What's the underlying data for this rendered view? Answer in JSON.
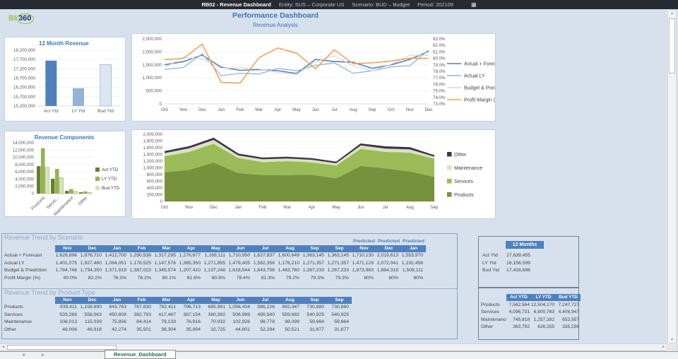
{
  "topbar": {
    "report": "RB02 - Revenue Dashboard",
    "entity": "Entity: SUS – Corporate US",
    "scenario": "Scenario: BUD – Budget",
    "period": "Period: 202109"
  },
  "header": {
    "title": "Performance Dashboard",
    "subtitle": "Revenue Analysis",
    "logo_bi": "BI",
    "logo_360": "360"
  },
  "icons": {
    "calendar": "▦",
    "nav_left": "◄",
    "nav_right": "►",
    "arrow_up": "▲",
    "arrow_down": "▼",
    "arrow_left": "◄",
    "arrow_right": "►"
  },
  "colors": {
    "accent_blue": "#4f81bd",
    "light_blue": "#95b3d7",
    "pale_blue": "#dce6f1",
    "orange": "#f2a15c",
    "products_green": "#76923c",
    "services_green": "#9bbb59",
    "maintenance_green": "#d7e4bc",
    "other_purple": "#403152",
    "title_blue": "#3f76b4",
    "tab_green": "#1e7145",
    "topbar_bg": "#262a31",
    "sheet_bg": "#d7e1ee"
  },
  "chart_data": [
    {
      "id": "twelve-month-revenue",
      "type": "bar",
      "title": "12 Month Revenue",
      "categories": [
        "Act Ytd",
        "LY Ytd",
        "Bud Ytd"
      ],
      "values": [
        17639455,
        16156599,
        17428696
      ],
      "bar_colors": [
        "#4f81bd",
        "#95b3d7",
        "#dce6f1"
      ],
      "ylim": [
        15200000,
        18200000
      ],
      "ystep": 500000,
      "grid": true,
      "legend_position": "none"
    },
    {
      "id": "revenue-analysis",
      "type": "line",
      "title": "Revenue Analysis",
      "x": [
        "Oct",
        "Nov",
        "Dec",
        "Jan",
        "Feb",
        "Mar",
        "Apr",
        "May",
        "Jun",
        "Jul",
        "Aug",
        "Sep",
        "Oct",
        "Nov",
        "Dec"
      ],
      "ylim": [
        0,
        2500000
      ],
      "ystep": 500000,
      "y2lim": [
        73,
        83
      ],
      "y2step": 1,
      "grid": true,
      "legend_position": "right",
      "series": [
        {
          "name": "Actual + Forecast",
          "color": "#4f81bd",
          "width": 1.6,
          "values": [
            1502000,
            1628896,
            1878710,
            1412700,
            1290538,
            1317295,
            1276677,
            1169111,
            1710950,
            1627837,
            1600649,
            1363145,
            1500000,
            1710130,
            2019613
          ]
        },
        {
          "name": "Actual LY",
          "color": "#95b3d7",
          "width": 1.3,
          "values": [
            1320000,
            1401075,
            1927480,
            1084051,
            1178525,
            1147576,
            1365350,
            1271855,
            1479405,
            1582356,
            1176210,
            1271357,
            1420000,
            1471129,
            2072041
          ]
        },
        {
          "name": "Budget & Prediction",
          "color": "#d8d8d8",
          "width": 1.2,
          "values": [
            1400000,
            1784746,
            1734250,
            1371919,
            1387023,
            1345574,
            1207410,
            1137248,
            1618544,
            1843756,
            1463760,
            1267233,
            1520000,
            1873983,
            1864319
          ]
        },
        {
          "name": "Profit Margin (%)",
          "color": "#f2a15c",
          "width": 1.6,
          "axis": "right",
          "values": [
            79.8,
            80.0,
            82.2,
            76.3,
            76.2,
            80.1,
            81.6,
            80.8,
            78.4,
            81.3,
            79.2,
            79.3,
            79.6,
            80,
            80
          ]
        }
      ]
    },
    {
      "id": "revenue-components",
      "type": "bar",
      "title": "Revenue Components",
      "categories": [
        "Products",
        "Servic...",
        "Maintenance",
        "Other"
      ],
      "ylim": [
        0,
        14000000
      ],
      "ystep": 2000000,
      "grid": true,
      "legend_position": "right",
      "series": [
        {
          "name": "Act YTD",
          "color": "#667d33",
          "values": [
            7562564,
            4096731,
            745818,
            363792
          ]
        },
        {
          "name": "LY YTD",
          "color": "#94b353",
          "values": [
            12504170,
            6800783,
            1257382,
            626255
          ]
        },
        {
          "name": "Bud YTD",
          "color": "#d6e3bb",
          "values": [
            7247727,
            4406947,
            652557,
            335236
          ]
        }
      ]
    },
    {
      "id": "revenue-components-trend",
      "type": "area",
      "x": [
        "Oct",
        "Nov",
        "Dec",
        "Jan",
        "Feb",
        "Mar",
        "Apr",
        "May",
        "Jun",
        "Jul",
        "Aug",
        "Sep"
      ],
      "ylim": [
        0,
        2000000
      ],
      "ystep": 200000,
      "grid": true,
      "legend_position": "right",
      "legend_order": [
        "Other",
        "Maintenance",
        "Services",
        "Products"
      ],
      "series": [
        {
          "name": "Products",
          "color": "#76923c",
          "values": [
            870000,
            939411,
            1158690,
            843763,
            787830,
            782411,
            796713,
            685961,
            1056434,
            986226,
            892347,
            730880
          ]
        },
        {
          "name": "Services",
          "color": "#9bbb59",
          "values": [
            470000,
            533266,
            558063,
            450808,
            382793,
            417447,
            367154,
            380392,
            506989,
            490540,
            559682,
            540925
          ]
        },
        {
          "name": "Maintenance",
          "color": "#d7e4bc",
          "values": [
            100000,
            108013,
            115039,
            75856,
            84414,
            79133,
            76916,
            70032,
            102926,
            98778,
            98099,
            59664
          ]
        },
        {
          "name": "Other",
          "color": "#403152",
          "values": [
            45000,
            48006,
            48918,
            42274,
            35501,
            38304,
            35894,
            32725,
            44601,
            52294,
            50521,
            31677
          ]
        }
      ]
    }
  ],
  "tables": {
    "scenario": {
      "title": "Revenue Trend by Scenario",
      "predicted_label": "Predicted",
      "predicted_from": 12,
      "columns": [
        "Nov",
        "Dec",
        "Jan",
        "Feb",
        "Mar",
        "Apr",
        "May",
        "Jun",
        "Jul",
        "Aug",
        "Sep",
        "Sep",
        "Nov",
        "Dec",
        "Jan"
      ],
      "rows": [
        {
          "label": "Actual + Forecast",
          "values": [
            "1,628,896",
            "1,878,710",
            "1,412,700",
            "1,290,538",
            "1,317,295",
            "1,276,677",
            "1,169,111",
            "1,710,950",
            "1,627,837",
            "1,600,649",
            "1,363,145",
            "1,363,145",
            "1,710,130",
            "2,019,613",
            "1,553,970"
          ]
        },
        {
          "label": "Actual LY",
          "values": [
            "1,401,075",
            "1,927,480",
            "1,084,051",
            "1,178,525",
            "1,147,576",
            "1,365,350",
            "1,271,855",
            "1,479,405",
            "1,582,356",
            "1,176,210",
            "1,271,357",
            "1,271,357",
            "1,471,129",
            "2,072,041",
            "1,192,458"
          ]
        },
        {
          "label": "Budget & Prediction",
          "values": [
            "1,784,746",
            "1,734,250",
            "1,371,919",
            "1,387,023",
            "1,345,574",
            "1,207,410",
            "1,137,248",
            "1,618,544",
            "1,843,756",
            "1,463,760",
            "1,267,233",
            "1,267,233",
            "1,873,983",
            "1,864,319",
            "1,509,111"
          ]
        },
        {
          "label": "Profit Margin (%)",
          "values": [
            "80.0%",
            "82.2%",
            "76.3%",
            "76.2%",
            "80.1%",
            "81.6%",
            "80.8%",
            "78.4%",
            "81.3%",
            "79.2%",
            "79.3%",
            "79.3%",
            "80%",
            "80%",
            "80%"
          ]
        }
      ]
    },
    "product": {
      "title": "Revenue Trend by Product Type",
      "columns": [
        "Nov",
        "Dec",
        "Jan",
        "Feb",
        "Mar",
        "Apr",
        "May",
        "Jun",
        "Jul",
        "Aug",
        "Sep",
        "Sep"
      ],
      "rows": [
        {
          "label": "Products",
          "values": [
            "939,411",
            "1,158,690",
            "843,763",
            "787,830",
            "782,411",
            "796,713",
            "685,961",
            "1,056,434",
            "986,226",
            "892,347",
            "730,880",
            "730,880"
          ]
        },
        {
          "label": "Services",
          "values": [
            "533,266",
            "558,063",
            "450,808",
            "382,793",
            "417,447",
            "367,154",
            "380,392",
            "506,989",
            "490,540",
            "559,682",
            "540,925",
            "540,925"
          ]
        },
        {
          "label": "Maintenance",
          "values": [
            "108,013",
            "115,039",
            "75,856",
            "84,414",
            "79,133",
            "76,916",
            "70,032",
            "102,926",
            "98,778",
            "98,099",
            "59,664",
            "59,664"
          ]
        },
        {
          "label": "Other",
          "values": [
            "48,006",
            "48,918",
            "42,274",
            "35,501",
            "38,304",
            "35,894",
            "32,725",
            "44,601",
            "52,294",
            "50,521",
            "31,677",
            "31,677"
          ]
        }
      ]
    },
    "summary12": {
      "header": "12 Months",
      "rows": [
        {
          "label": "Act Ytd",
          "value": "17,639,455"
        },
        {
          "label": "LY Ytd",
          "value": "16,156,599"
        },
        {
          "label": "Bud Ytd",
          "value": "17,428,696"
        }
      ]
    },
    "product_ytd": {
      "columns": [
        "Act YTD",
        "LY YTD",
        "Bud YTD"
      ],
      "rows": [
        {
          "label": "Products",
          "values": [
            "7,562,564",
            "12,504,170",
            "7,247,727"
          ]
        },
        {
          "label": "Services",
          "values": [
            "4,096,731",
            "6,800,783",
            "4,406,947"
          ]
        },
        {
          "label": "Maintenance",
          "values": [
            "745,818",
            "1,257,382",
            "652,557"
          ]
        },
        {
          "label": "Other",
          "values": [
            "363,792",
            "626,255",
            "335,236"
          ]
        }
      ]
    }
  },
  "tabbar": {
    "sheet": "Revenue_Dashboard"
  }
}
